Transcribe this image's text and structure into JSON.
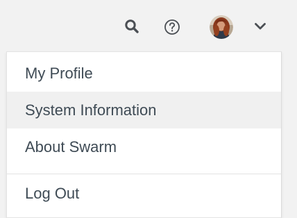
{
  "header": {
    "icons": {
      "search": "search-icon",
      "help": "help-icon",
      "avatar": "avatar",
      "chevron": "chevron-down-icon"
    },
    "icon_color": "#4b4f54"
  },
  "user_menu": {
    "items": [
      {
        "label": "My Profile"
      },
      {
        "label": "System Information"
      },
      {
        "label": "About Swarm"
      }
    ],
    "logout_label": "Log Out",
    "hover_background": "#f0f0f0",
    "text_color": "#3f4b55"
  }
}
